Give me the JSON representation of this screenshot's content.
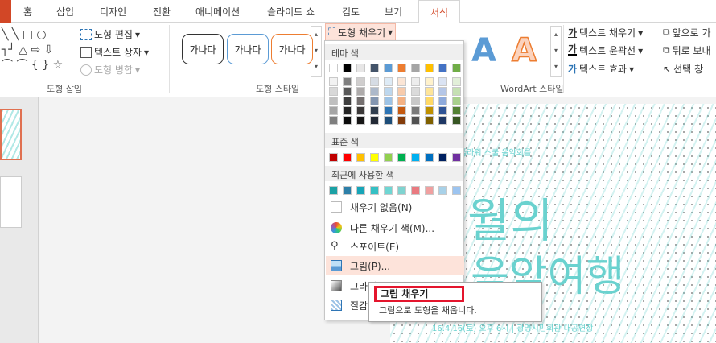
{
  "tabs": [
    {
      "label": "홈"
    },
    {
      "label": "삽입"
    },
    {
      "label": "디자인"
    },
    {
      "label": "전환"
    },
    {
      "label": "애니메이션"
    },
    {
      "label": "슬라이드 쇼"
    },
    {
      "label": "검토"
    },
    {
      "label": "보기"
    },
    {
      "label": "서식",
      "active": true
    }
  ],
  "ribbon": {
    "insert_shapes": {
      "label": "도형 삽입",
      "edit_shape": "도형 편집",
      "text_box": "텍스트 상자",
      "merge_shapes": "도형 병합"
    },
    "shape_styles": {
      "label": "도형 스타일",
      "samples": [
        "가나다",
        "가나다",
        "가나다"
      ],
      "sample_border_colors": [
        "#333333",
        "#5b9bd5",
        "#ed7d31"
      ],
      "fill_button": "도형 채우기"
    },
    "wordart": {
      "label": "WordArt 스타일",
      "letters": [
        "A",
        "A"
      ],
      "letter_colors": [
        "#5b9bd5",
        "#ed7d31"
      ],
      "text_fill": "텍스트 채우기",
      "text_outline": "텍스트 윤곽선",
      "text_effects": "텍스트 효과"
    },
    "arrange": {
      "bring_forward": "앞으로 가",
      "send_backward": "뒤로 보내",
      "selection_pane": "선택 창"
    }
  },
  "fill_menu": {
    "theme_colors_header": "테마 색",
    "theme_top_row": [
      "#ffffff",
      "#000000",
      "#e7e6e6",
      "#44546a",
      "#5b9bd5",
      "#ed7d31",
      "#a5a5a5",
      "#ffc000",
      "#4472c4",
      "#70ad47"
    ],
    "theme_shades": [
      [
        "#f2f2f2",
        "#7f7f7f",
        "#d0cece",
        "#d6dce4",
        "#deebf6",
        "#fbe5d5",
        "#ededed",
        "#fff2cc",
        "#dae3f3",
        "#e2efd9"
      ],
      [
        "#d8d8d8",
        "#595959",
        "#aeabab",
        "#adb9ca",
        "#bdd7ee",
        "#f7cbac",
        "#dbdbdb",
        "#fee599",
        "#b4c6e7",
        "#c5e0b3"
      ],
      [
        "#bfbfbf",
        "#3f3f3f",
        "#757070",
        "#8496b0",
        "#9dc3e6",
        "#f4b183",
        "#c9c9c9",
        "#ffd965",
        "#8eaadb",
        "#a8d08d"
      ],
      [
        "#a5a5a5",
        "#262626",
        "#3a3838",
        "#323f4f",
        "#2e75b5",
        "#c55a11",
        "#7b7b7b",
        "#bf9000",
        "#2f5496",
        "#538135"
      ],
      [
        "#7f7f7f",
        "#0c0c0c",
        "#171616",
        "#222a35",
        "#1e4e79",
        "#833c0b",
        "#525252",
        "#7f6000",
        "#1f3864",
        "#375623"
      ]
    ],
    "standard_colors_header": "표준 색",
    "standard_colors": [
      "#c00000",
      "#ff0000",
      "#ffc000",
      "#ffff00",
      "#92d050",
      "#00b050",
      "#00b0f0",
      "#0070c0",
      "#002060",
      "#7030a0"
    ],
    "recent_colors_header": "최근에 사용한 색",
    "recent_colors": [
      "#1ba1a5",
      "#2d7fa8",
      "#17a5b8",
      "#35c0c4",
      "#6fd6d3",
      "#7fd3d0",
      "#e97a80",
      "#f0a0a0",
      "#a8d1e8",
      "#9cc4f0"
    ],
    "items": [
      {
        "label": "채우기 없음(N)",
        "icon": "no-fill-icon"
      },
      {
        "label": "다른 채우기 색(M)...",
        "icon": "color-wheel-icon"
      },
      {
        "label": "스포이트(E)",
        "icon": "eyedropper-icon"
      },
      {
        "label": "그림(P)...",
        "icon": "picture-icon",
        "highlighted": true
      },
      {
        "label": "그라데이션(G)",
        "icon": "gradient-icon"
      },
      {
        "label": "질감(T)",
        "icon": "texture-icon"
      }
    ]
  },
  "tooltip": {
    "title": "그림 채우기",
    "description": "그림으로 도형을 채웁니다."
  },
  "slide": {
    "subtitle": "플라워 스쿨 음악회를",
    "title_line1": "월의",
    "title_line2": "음악여행",
    "footer": "16.4.16(토) 오후 6시 | 광명시민회관 대공연장"
  },
  "colors": {
    "accent": "#d24726",
    "highlight": "#fde3da",
    "tooltip_border": "#e4152d"
  }
}
